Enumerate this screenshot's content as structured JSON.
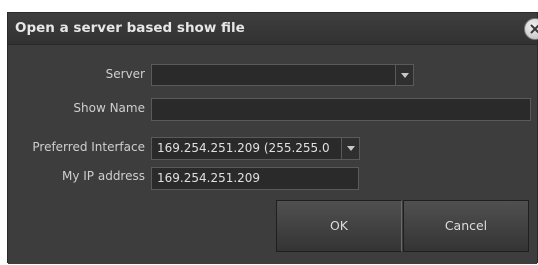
{
  "dialog": {
    "title": "Open a server based show file",
    "close_icon": "close-x-circle-icon"
  },
  "form": {
    "server_label": "Server",
    "server_value": "",
    "show_name_label": "Show Name",
    "show_name_value": "",
    "preferred_interface_label": "Preferred Interface",
    "preferred_interface_value": "169.254.251.209 (255.255.0",
    "my_ip_label": "My IP address",
    "my_ip_value": "169.254.251.209"
  },
  "buttons": {
    "ok_label": "OK",
    "cancel_label": "Cancel"
  }
}
